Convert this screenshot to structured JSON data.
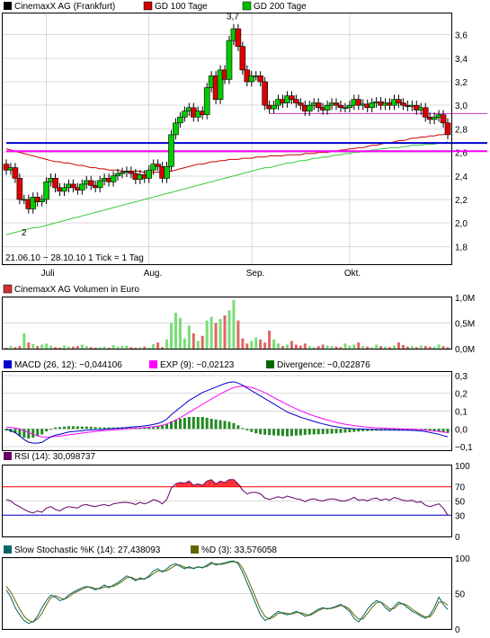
{
  "chart_data": [
    {
      "id": "price",
      "type": "candlestick",
      "legend": [
        {
          "label": "CinemaxX AG (Frankfurt)",
          "color": "#000000"
        },
        {
          "label": "GD 100 Tage",
          "color": "#cc0000"
        },
        {
          "label": "GD 200 Tage",
          "color": "#00bb00"
        }
      ],
      "ylim": [
        1.65,
        3.78
      ],
      "yticks": [
        "3,6",
        "3,4",
        "3,2",
        "3,0",
        "2,8",
        "2,6",
        "2,4",
        "2,2",
        "2,0",
        "1,8"
      ],
      "ytick_values": [
        3.6,
        3.4,
        3.2,
        3.0,
        2.8,
        2.6,
        2.4,
        2.2,
        2.0,
        1.8
      ],
      "x_categories": [
        "Juli",
        "Aug.",
        "Sep.",
        "Okt."
      ],
      "x_category_index": [
        9,
        32,
        55,
        77
      ],
      "n_days": 100,
      "range_note": "21.06.10 − 28.10.10   1 Tick = 1 Tag",
      "annotations": {
        "high_label": "3,7",
        "high_index": 51,
        "high_value": 3.7,
        "low_label": "2",
        "low_index": 4,
        "low_value": 2.0
      },
      "close": [
        2.45,
        2.47,
        2.38,
        2.2,
        2.2,
        2.12,
        2.22,
        2.18,
        2.2,
        2.35,
        2.38,
        2.3,
        2.27,
        2.3,
        2.33,
        2.3,
        2.28,
        2.33,
        2.36,
        2.32,
        2.3,
        2.36,
        2.38,
        2.35,
        2.4,
        2.42,
        2.43,
        2.44,
        2.42,
        2.37,
        2.41,
        2.38,
        2.45,
        2.5,
        2.48,
        2.38,
        2.48,
        2.75,
        2.85,
        2.9,
        2.95,
        2.98,
        2.9,
        2.95,
        2.92,
        3.15,
        3.25,
        3.05,
        3.3,
        3.22,
        3.55,
        3.65,
        3.5,
        3.3,
        3.2,
        3.25,
        3.25,
        3.2,
        3.0,
        2.97,
        3.0,
        3.05,
        3.02,
        3.08,
        3.05,
        3.02,
        3.0,
        2.95,
        3.0,
        3.02,
        2.98,
        2.96,
        3.0,
        3.02,
        3.0,
        2.98,
        2.98,
        3.0,
        3.05,
        3.0,
        3.01,
        2.98,
        3.02,
        3.03,
        3.0,
        3.02,
        3.0,
        3.05,
        3.02,
        3.0,
        2.99,
        3.0,
        2.96,
        2.98,
        2.9,
        2.88,
        2.9,
        2.92,
        2.85,
        2.75
      ],
      "open": [
        2.5,
        2.45,
        2.47,
        2.38,
        2.2,
        2.2,
        2.12,
        2.22,
        2.18,
        2.2,
        2.35,
        2.38,
        2.3,
        2.27,
        2.3,
        2.33,
        2.3,
        2.28,
        2.33,
        2.36,
        2.32,
        2.3,
        2.36,
        2.38,
        2.35,
        2.4,
        2.42,
        2.43,
        2.44,
        2.42,
        2.37,
        2.41,
        2.38,
        2.45,
        2.5,
        2.48,
        2.38,
        2.48,
        2.75,
        2.85,
        2.9,
        2.95,
        2.98,
        2.9,
        2.95,
        2.92,
        3.15,
        3.25,
        3.05,
        3.3,
        3.22,
        3.55,
        3.65,
        3.5,
        3.3,
        3.2,
        3.25,
        3.25,
        3.2,
        3.0,
        2.97,
        3.0,
        3.05,
        3.02,
        3.08,
        3.05,
        3.02,
        3.0,
        2.95,
        3.0,
        3.02,
        2.98,
        2.96,
        3.0,
        3.02,
        3.0,
        2.98,
        2.98,
        3.0,
        3.05,
        3.0,
        3.01,
        2.98,
        3.02,
        3.03,
        3.0,
        3.02,
        3.0,
        3.05,
        3.02,
        3.0,
        2.99,
        3.0,
        2.96,
        2.98,
        2.9,
        2.88,
        2.9,
        2.92,
        2.85
      ],
      "gd100": [
        2.63,
        2.62,
        2.61,
        2.6,
        2.59,
        2.58,
        2.57,
        2.56,
        2.55,
        2.54,
        2.53,
        2.52,
        2.52,
        2.51,
        2.51,
        2.5,
        2.49,
        2.49,
        2.48,
        2.47,
        2.47,
        2.46,
        2.46,
        2.45,
        2.45,
        2.45,
        2.44,
        2.44,
        2.44,
        2.44,
        2.44,
        2.43,
        2.43,
        2.43,
        2.43,
        2.43,
        2.44,
        2.44,
        2.45,
        2.46,
        2.47,
        2.48,
        2.49,
        2.5,
        2.5,
        2.51,
        2.52,
        2.52,
        2.53,
        2.53,
        2.54,
        2.54,
        2.54,
        2.55,
        2.55,
        2.55,
        2.56,
        2.56,
        2.56,
        2.57,
        2.57,
        2.57,
        2.57,
        2.58,
        2.58,
        2.58,
        2.58,
        2.59,
        2.59,
        2.59,
        2.6,
        2.6,
        2.6,
        2.61,
        2.61,
        2.62,
        2.62,
        2.63,
        2.63,
        2.64,
        2.64,
        2.65,
        2.66,
        2.66,
        2.67,
        2.68,
        2.68,
        2.69,
        2.7,
        2.7,
        2.71,
        2.72,
        2.72,
        2.73,
        2.73,
        2.74,
        2.74,
        2.75,
        2.75,
        2.76
      ],
      "gd200": [
        1.9,
        1.91,
        1.92,
        1.93,
        1.94,
        1.95,
        1.96,
        1.96,
        1.97,
        1.98,
        1.99,
        2.0,
        2.01,
        2.02,
        2.03,
        2.04,
        2.05,
        2.06,
        2.07,
        2.08,
        2.09,
        2.1,
        2.11,
        2.12,
        2.13,
        2.14,
        2.15,
        2.16,
        2.17,
        2.18,
        2.19,
        2.2,
        2.21,
        2.22,
        2.23,
        2.24,
        2.25,
        2.26,
        2.27,
        2.28,
        2.29,
        2.3,
        2.31,
        2.32,
        2.33,
        2.34,
        2.35,
        2.36,
        2.37,
        2.38,
        2.39,
        2.4,
        2.41,
        2.42,
        2.43,
        2.44,
        2.45,
        2.46,
        2.47,
        2.47,
        2.48,
        2.49,
        2.5,
        2.51,
        2.51,
        2.52,
        2.53,
        2.53,
        2.54,
        2.55,
        2.55,
        2.56,
        2.56,
        2.57,
        2.58,
        2.58,
        2.59,
        2.59,
        2.6,
        2.6,
        2.61,
        2.61,
        2.62,
        2.62,
        2.63,
        2.63,
        2.64,
        2.64,
        2.64,
        2.65,
        2.65,
        2.66,
        2.66,
        2.66,
        2.67,
        2.67,
        2.67,
        2.68,
        2.68,
        2.69
      ],
      "hlines": [
        {
          "value": 2.93,
          "color": "#cc33cc",
          "from_index": 59,
          "to_index": 99
        },
        {
          "value": 2.68,
          "color": "#0000cc",
          "from_index": 0,
          "to_index": 99
        },
        {
          "value": 2.61,
          "color": "#ff00ff",
          "from_index": 0,
          "to_index": 99
        }
      ]
    },
    {
      "id": "volume",
      "type": "bar",
      "legend": [
        {
          "label": "CinemaxX AG Volumen in Euro",
          "color": "#cc3333"
        }
      ],
      "ylim": [
        0,
        1.0
      ],
      "yticks": [
        "1,0M",
        "0,5M",
        "0,0M"
      ],
      "ytick_values": [
        1.0,
        0.5,
        0.0
      ],
      "values": [
        0.02,
        0.05,
        0.03,
        0.05,
        0.3,
        0.12,
        0.09,
        0.05,
        0.08,
        0.1,
        0.06,
        0.03,
        0.02,
        0.06,
        0.04,
        0.04,
        0.05,
        0.08,
        0.05,
        0.03,
        0.02,
        0.03,
        0.04,
        0.02,
        0.07,
        0.04,
        0.05,
        0.06,
        0.03,
        0.02,
        0.03,
        0.04,
        0.02,
        0.09,
        0.12,
        0.03,
        0.18,
        0.5,
        0.7,
        0.6,
        0.2,
        0.45,
        0.3,
        0.15,
        0.25,
        0.55,
        0.62,
        0.5,
        0.58,
        0.65,
        0.75,
        0.95,
        0.55,
        0.2,
        0.1,
        0.15,
        0.22,
        0.18,
        0.12,
        0.35,
        0.18,
        0.1,
        0.05,
        0.08,
        0.15,
        0.08,
        0.06,
        0.1,
        0.05,
        0.03,
        0.05,
        0.08,
        0.06,
        0.05,
        0.04,
        0.03,
        0.1,
        0.06,
        0.08,
        0.12,
        0.05,
        0.04,
        0.03,
        0.08,
        0.05,
        0.04,
        0.03,
        0.06,
        0.12,
        0.07,
        0.04,
        0.05,
        0.03,
        0.06,
        0.05,
        0.04,
        0.04,
        0.08,
        0.05,
        0.03
      ]
    },
    {
      "id": "macd",
      "type": "line+bar",
      "legend": [
        {
          "label": "MACD (26, 12): −0,044106",
          "color": "#0000cc"
        },
        {
          "label": "EXP (9): −0,02123",
          "color": "#ff00ff"
        },
        {
          "label": "Divergence: −0,022876",
          "color": "#006600"
        }
      ],
      "ylim": [
        -0.12,
        0.32
      ],
      "yticks": [
        "0,3",
        "0,2",
        "0,1",
        "0,0",
        "−0,1"
      ],
      "ytick_values": [
        0.3,
        0.2,
        0.1,
        0.0,
        -0.1
      ],
      "macd": [
        0.0,
        -0.01,
        -0.02,
        -0.04,
        -0.06,
        -0.075,
        -0.08,
        -0.08,
        -0.076,
        -0.06,
        -0.045,
        -0.035,
        -0.03,
        -0.024,
        -0.018,
        -0.015,
        -0.013,
        -0.011,
        -0.008,
        -0.006,
        -0.005,
        -0.004,
        -0.002,
        0.0,
        0.002,
        0.004,
        0.006,
        0.008,
        0.01,
        0.012,
        0.014,
        0.017,
        0.02,
        0.025,
        0.03,
        0.04,
        0.055,
        0.08,
        0.1,
        0.12,
        0.14,
        0.16,
        0.175,
        0.19,
        0.205,
        0.215,
        0.225,
        0.235,
        0.245,
        0.255,
        0.262,
        0.265,
        0.258,
        0.245,
        0.23,
        0.215,
        0.2,
        0.185,
        0.17,
        0.155,
        0.14,
        0.125,
        0.11,
        0.095,
        0.085,
        0.075,
        0.065,
        0.058,
        0.05,
        0.042,
        0.035,
        0.028,
        0.022,
        0.016,
        0.012,
        0.008,
        0.005,
        0.003,
        0.001,
        0.0,
        -0.001,
        -0.002,
        -0.003,
        -0.004,
        -0.005,
        -0.005,
        -0.006,
        -0.006,
        -0.007,
        -0.007,
        -0.008,
        -0.008,
        -0.01,
        -0.012,
        -0.015,
        -0.02,
        -0.025,
        -0.03,
        -0.038,
        -0.044106
      ],
      "exp": [
        0.01,
        0.008,
        0.005,
        0.0,
        -0.01,
        -0.02,
        -0.03,
        -0.04,
        -0.045,
        -0.046,
        -0.045,
        -0.043,
        -0.04,
        -0.037,
        -0.033,
        -0.03,
        -0.027,
        -0.024,
        -0.021,
        -0.018,
        -0.015,
        -0.012,
        -0.01,
        -0.008,
        -0.006,
        -0.004,
        -0.002,
        0.0,
        0.002,
        0.004,
        0.006,
        0.008,
        0.01,
        0.012,
        0.015,
        0.02,
        0.028,
        0.038,
        0.05,
        0.063,
        0.078,
        0.093,
        0.108,
        0.123,
        0.138,
        0.153,
        0.168,
        0.182,
        0.196,
        0.21,
        0.222,
        0.232,
        0.238,
        0.24,
        0.238,
        0.232,
        0.225,
        0.215,
        0.203,
        0.19,
        0.177,
        0.163,
        0.15,
        0.137,
        0.125,
        0.113,
        0.102,
        0.092,
        0.082,
        0.073,
        0.065,
        0.057,
        0.05,
        0.043,
        0.037,
        0.031,
        0.026,
        0.022,
        0.018,
        0.015,
        0.012,
        0.01,
        0.008,
        0.006,
        0.005,
        0.004,
        0.003,
        0.002,
        0.001,
        0.0,
        -0.001,
        -0.002,
        -0.003,
        -0.005,
        -0.007,
        -0.009,
        -0.012,
        -0.015,
        -0.018,
        -0.02123
      ],
      "divergence": [
        -0.01,
        -0.018,
        -0.025,
        -0.04,
        -0.05,
        -0.055,
        -0.05,
        -0.04,
        -0.031,
        -0.014,
        0.0,
        0.008,
        0.01,
        0.013,
        0.015,
        0.015,
        0.014,
        0.013,
        0.013,
        0.012,
        0.01,
        0.008,
        0.008,
        0.008,
        0.008,
        0.008,
        0.008,
        0.008,
        0.008,
        0.008,
        0.008,
        0.009,
        0.01,
        0.013,
        0.015,
        0.02,
        0.027,
        0.042,
        0.05,
        0.057,
        0.062,
        0.067,
        0.067,
        0.067,
        0.067,
        0.062,
        0.057,
        0.053,
        0.049,
        0.045,
        0.04,
        0.033,
        0.02,
        0.005,
        -0.008,
        -0.017,
        -0.025,
        -0.03,
        -0.033,
        -0.035,
        -0.037,
        -0.038,
        -0.04,
        -0.042,
        -0.04,
        -0.038,
        -0.037,
        -0.034,
        -0.032,
        -0.031,
        -0.03,
        -0.029,
        -0.028,
        -0.027,
        -0.025,
        -0.023,
        -0.021,
        -0.019,
        -0.017,
        -0.015,
        -0.013,
        -0.012,
        -0.011,
        -0.01,
        -0.01,
        -0.009,
        -0.009,
        -0.008,
        -0.008,
        -0.007,
        -0.007,
        -0.006,
        -0.007,
        -0.007,
        -0.008,
        -0.011,
        -0.013,
        -0.015,
        -0.02,
        -0.022876
      ]
    },
    {
      "id": "rsi",
      "type": "line",
      "legend": [
        {
          "label": "RSI (14): 30,098737",
          "color": "#660066"
        }
      ],
      "ylim": [
        0,
        100
      ],
      "yticks": [
        "100",
        "70",
        "50",
        "30",
        "0"
      ],
      "ytick_values": [
        100,
        70,
        50,
        30,
        0
      ],
      "levels": [
        {
          "value": 70,
          "color": "#ff0000"
        },
        {
          "value": 30,
          "color": "#0000cc"
        }
      ],
      "values": [
        52,
        50,
        45,
        42,
        38,
        35,
        33,
        36,
        34,
        40,
        42,
        38,
        36,
        40,
        42,
        41,
        40,
        44,
        45,
        43,
        42,
        44,
        45,
        43,
        46,
        47,
        48,
        48,
        47,
        45,
        48,
        46,
        48,
        52,
        50,
        46,
        52,
        68,
        74,
        76,
        75,
        78,
        72,
        74,
        72,
        78,
        80,
        74,
        78,
        76,
        80,
        80,
        74,
        65,
        60,
        62,
        62,
        60,
        54,
        52,
        54,
        56,
        54,
        57,
        55,
        53,
        52,
        49,
        52,
        53,
        51,
        50,
        52,
        53,
        52,
        50,
        50,
        52,
        55,
        51,
        52,
        50,
        53,
        54,
        51,
        53,
        51,
        55,
        53,
        51,
        50,
        51,
        48,
        49,
        44,
        42,
        44,
        46,
        40,
        30.098737
      ]
    },
    {
      "id": "stochastic",
      "type": "line",
      "legend": [
        {
          "label": "Slow Stochastic %K (14): 27,438093",
          "color": "#006666"
        },
        {
          "label": "%D (3): 33,576058",
          "color": "#666600"
        }
      ],
      "ylim": [
        0,
        100
      ],
      "yticks": [
        "100",
        "50",
        "0"
      ],
      "ytick_values": [
        100,
        50,
        0
      ],
      "k": [
        55,
        45,
        30,
        20,
        12,
        8,
        10,
        18,
        30,
        40,
        48,
        45,
        40,
        42,
        48,
        52,
        55,
        58,
        60,
        58,
        55,
        58,
        62,
        58,
        62,
        65,
        70,
        75,
        72,
        68,
        72,
        70,
        75,
        82,
        85,
        80,
        85,
        90,
        92,
        88,
        85,
        88,
        85,
        88,
        86,
        90,
        94,
        90,
        92,
        93,
        95,
        96,
        92,
        80,
        65,
        50,
        35,
        20,
        12,
        15,
        20,
        25,
        22,
        20,
        22,
        25,
        22,
        18,
        20,
        24,
        28,
        30,
        28,
        30,
        32,
        35,
        30,
        25,
        15,
        10,
        18,
        28,
        35,
        40,
        38,
        30,
        25,
        32,
        38,
        35,
        30,
        25,
        22,
        18,
        15,
        20,
        30,
        45,
        35,
        27.438093
      ],
      "d": [
        60,
        52,
        40,
        28,
        18,
        12,
        10,
        14,
        22,
        34,
        44,
        47,
        44,
        42,
        45,
        50,
        53,
        56,
        59,
        59,
        57,
        57,
        59,
        60,
        60,
        63,
        67,
        72,
        73,
        70,
        70,
        71,
        73,
        78,
        82,
        82,
        82,
        86,
        90,
        90,
        87,
        86,
        86,
        87,
        87,
        88,
        92,
        92,
        91,
        92,
        94,
        95,
        94,
        86,
        73,
        58,
        43,
        28,
        18,
        14,
        17,
        22,
        23,
        22,
        21,
        23,
        23,
        21,
        19,
        22,
        26,
        29,
        29,
        29,
        31,
        33,
        32,
        28,
        20,
        14,
        14,
        22,
        30,
        37,
        38,
        34,
        28,
        29,
        35,
        36,
        33,
        28,
        24,
        20,
        17,
        17,
        25,
        38,
        38,
        33.576058
      ]
    }
  ]
}
